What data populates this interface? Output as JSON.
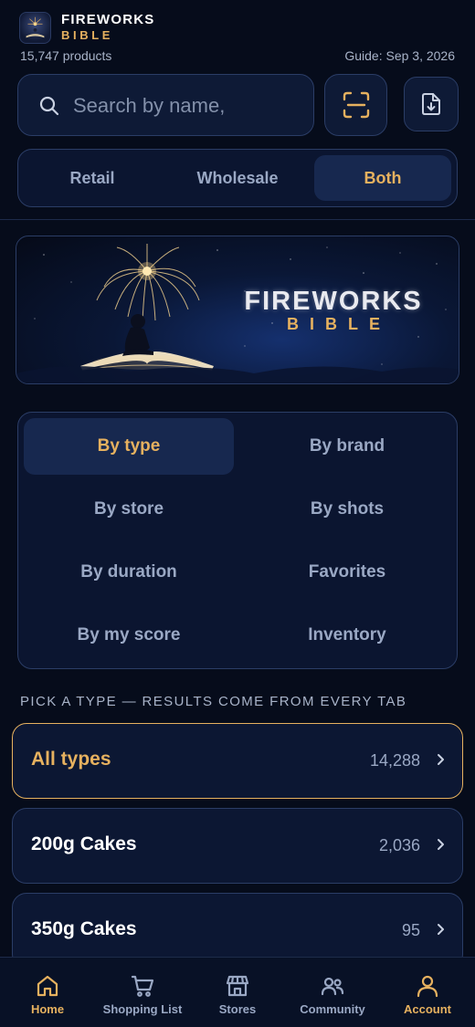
{
  "header": {
    "brand_title": "FIREWORKS",
    "brand_sub": "BIBLE",
    "product_count": "15,747 products",
    "guide_date": "Guide: Sep 3, 2026"
  },
  "search": {
    "placeholder": "Search by name,",
    "value": ""
  },
  "icons": {
    "search": "search-icon",
    "scan": "scan-icon",
    "export": "file-download-icon",
    "chevron": "chevron-right-icon"
  },
  "segment": {
    "options": [
      "Retail",
      "Wholesale",
      "Both"
    ],
    "selected": "Both"
  },
  "banner": {
    "title": "FIREWORKS",
    "subtitle": "BIBLE"
  },
  "filters": {
    "items": [
      "By type",
      "By brand",
      "By store",
      "By shots",
      "By duration",
      "Favorites",
      "By my score",
      "Inventory"
    ],
    "selected": "By type"
  },
  "section_label": "PICK A TYPE — RESULTS COME FROM EVERY TAB",
  "types": [
    {
      "name": "All types",
      "count": "14,288",
      "selected": true
    },
    {
      "name": "200g Cakes",
      "count": "2,036",
      "selected": false
    },
    {
      "name": "350g Cakes",
      "count": "95",
      "selected": false
    }
  ],
  "tabbar": {
    "items": [
      {
        "label": "Home",
        "icon": "home-icon"
      },
      {
        "label": "Shopping List",
        "icon": "cart-icon"
      },
      {
        "label": "Stores",
        "icon": "store-icon"
      },
      {
        "label": "Community",
        "icon": "people-icon"
      },
      {
        "label": "Account",
        "icon": "user-icon"
      }
    ]
  },
  "colors": {
    "background": "#060c1b",
    "accent": "#e6b15f",
    "panel": "#0b1530",
    "border": "#2b3d66",
    "muted_text": "#9aa8c4"
  }
}
